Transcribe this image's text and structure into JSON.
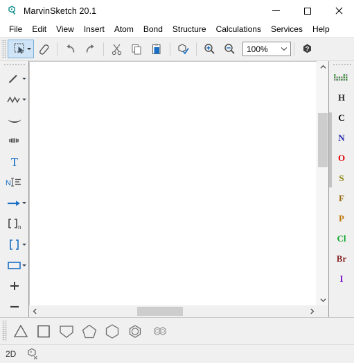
{
  "window": {
    "title": "MarvinSketch 20.1",
    "logo_icon": "marvin-logo-icon",
    "minimize_label": "─",
    "maximize_label": "□",
    "close_label": "✕"
  },
  "menubar": {
    "items": [
      {
        "label": "File"
      },
      {
        "label": "Edit"
      },
      {
        "label": "View"
      },
      {
        "label": "Insert"
      },
      {
        "label": "Atom"
      },
      {
        "label": "Bond"
      },
      {
        "label": "Structure"
      },
      {
        "label": "Calculations"
      },
      {
        "label": "Services"
      },
      {
        "label": "Help"
      }
    ]
  },
  "toolbar": {
    "buttons": [
      {
        "name": "select-tool",
        "icon": "selection-rectangle-icon",
        "active": true,
        "dropdown": true
      },
      {
        "name": "eraser-tool",
        "icon": "eraser-icon",
        "active": false,
        "dropdown": false
      },
      {
        "name": "undo-button",
        "icon": "undo-arrow-icon",
        "active": false,
        "dropdown": false
      },
      {
        "name": "redo-button",
        "icon": "redo-arrow-icon",
        "active": false,
        "dropdown": false
      },
      {
        "name": "cut-button",
        "icon": "scissors-icon",
        "active": false,
        "dropdown": false
      },
      {
        "name": "copy-button",
        "icon": "copy-pages-icon",
        "active": false,
        "dropdown": false
      },
      {
        "name": "paste-button",
        "icon": "clipboard-paste-icon",
        "active": false,
        "dropdown": false
      },
      {
        "name": "structure-check-button",
        "icon": "hexagon-check-icon",
        "active": false,
        "dropdown": false
      },
      {
        "name": "zoom-in-button",
        "icon": "magnifier-plus-icon",
        "active": false,
        "dropdown": false
      },
      {
        "name": "zoom-out-button",
        "icon": "magnifier-minus-icon",
        "active": false,
        "dropdown": false
      }
    ],
    "zoom_value": "100%",
    "help_icon": "help-hexagon-icon"
  },
  "left_toolbar": {
    "tools": [
      {
        "name": "single-bond-tool",
        "icon": "single-bond-icon",
        "dropdown": true
      },
      {
        "name": "chain-tool",
        "icon": "zigzag-chain-icon",
        "dropdown": true
      },
      {
        "name": "wedge-bond-tool",
        "icon": "wedge-bond-icon",
        "dropdown": false
      },
      {
        "name": "hash-bond-tool",
        "icon": "hashed-bond-icon",
        "dropdown": false
      },
      {
        "name": "text-tool",
        "icon": "text-t-icon",
        "dropdown": false
      },
      {
        "name": "atom-label-tool",
        "icon": "atom-label-n-icon",
        "dropdown": false
      },
      {
        "name": "reaction-arrow-tool",
        "icon": "right-arrow-icon",
        "dropdown": true
      },
      {
        "name": "polymer-bracket-tool",
        "icon": "bracket-n-icon",
        "dropdown": false
      },
      {
        "name": "bracket-tool",
        "icon": "blue-brackets-icon",
        "dropdown": true
      },
      {
        "name": "rectangle-tool",
        "icon": "rectangle-icon",
        "dropdown": true
      },
      {
        "name": "increase-charge-tool",
        "icon": "plus-icon",
        "dropdown": false
      },
      {
        "name": "decrease-charge-tool",
        "icon": "minus-icon",
        "dropdown": false
      }
    ]
  },
  "element_palette": {
    "periodic_table_icon": "periodic-table-icon",
    "elements": [
      {
        "symbol": "H",
        "color": "#2b2b2b"
      },
      {
        "symbol": "C",
        "color": "#000000"
      },
      {
        "symbol": "N",
        "color": "#2a2ab0"
      },
      {
        "symbol": "O",
        "color": "#e00000"
      },
      {
        "symbol": "S",
        "color": "#888008"
      },
      {
        "symbol": "F",
        "color": "#9a6a10"
      },
      {
        "symbol": "P",
        "color": "#c07808"
      },
      {
        "symbol": "Cl",
        "color": "#12a830"
      },
      {
        "symbol": "Br",
        "color": "#8a2b2b"
      },
      {
        "symbol": "I",
        "color": "#7a16c8"
      }
    ]
  },
  "templates": {
    "items": [
      {
        "name": "cyclopropane-template",
        "icon": "triangle-icon"
      },
      {
        "name": "cyclobutane-template",
        "icon": "square-icon"
      },
      {
        "name": "cyclopentadiene-template",
        "icon": "flat-top-pentagon-icon"
      },
      {
        "name": "cyclopentane-template",
        "icon": "pentagon-icon"
      },
      {
        "name": "cyclohexane-template",
        "icon": "hexagon-icon"
      },
      {
        "name": "benzene-template",
        "icon": "benzene-ring-icon"
      },
      {
        "name": "naphthalene-template",
        "icon": "naphthalene-icon"
      }
    ]
  },
  "statusbar": {
    "dimension": "2D",
    "structure_icon": "hexagon-x-icon"
  },
  "canvas": {
    "vertical_scrollbar": {
      "up_arrow": "⌃",
      "down_arrow": "⌄"
    },
    "horizontal_scrollbar": {
      "left_arrow": "‹",
      "right_arrow": "›"
    }
  },
  "colors": {
    "accent_blue": "#1a6fc4",
    "toolbar_bg": "#f0f0f0",
    "canvas_bg": "#ffffff",
    "active_tool_bg": "#cfe4f7"
  }
}
